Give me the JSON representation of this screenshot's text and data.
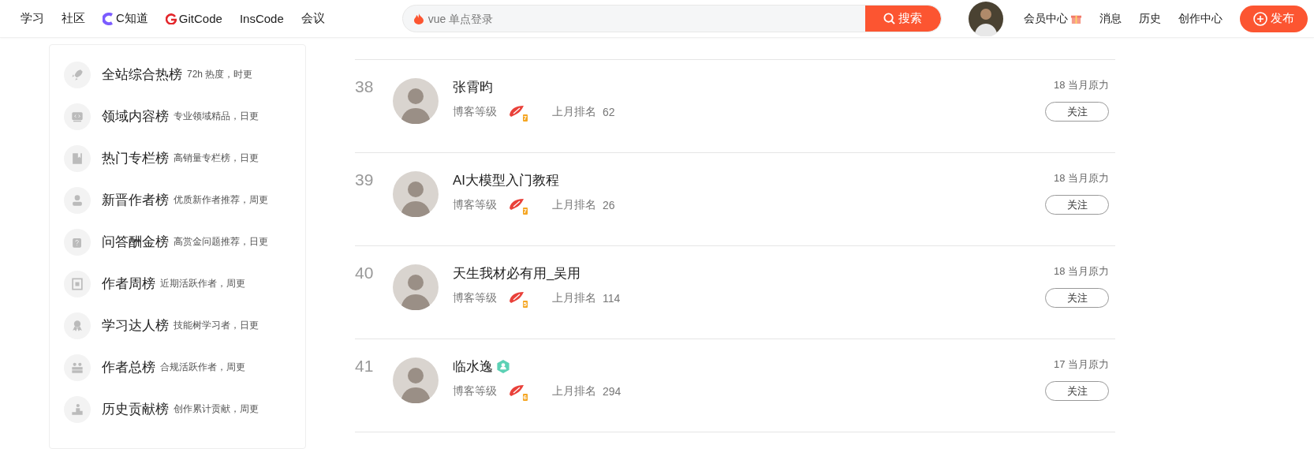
{
  "nav": {
    "links": [
      {
        "label": "学习",
        "kind": "plain"
      },
      {
        "label": "社区",
        "kind": "plain"
      },
      {
        "label": "C知道",
        "kind": "cknow"
      },
      {
        "label": "GitCode",
        "kind": "gitcode"
      },
      {
        "label": "InsCode",
        "kind": "plain"
      },
      {
        "label": "会议",
        "kind": "plain"
      }
    ],
    "search": {
      "placeholder": "vue 单点登录",
      "button": "搜索"
    },
    "user_links": [
      {
        "label": "会员中心",
        "gift": true
      },
      {
        "label": "消息",
        "gift": false
      },
      {
        "label": "历史",
        "gift": false
      },
      {
        "label": "创作中心",
        "gift": false
      }
    ],
    "publish": "发布"
  },
  "sidebar": {
    "items": [
      {
        "kind": "rocket",
        "title": "全站综合热榜",
        "desc": "72h 热度，时更",
        "selected": false
      },
      {
        "kind": "code",
        "title": "领域内容榜",
        "desc": "专业领域精品，日更",
        "selected": false
      },
      {
        "kind": "book",
        "title": "热门专栏榜",
        "desc": "高销量专栏榜，日更",
        "selected": false
      },
      {
        "kind": "person",
        "title": "新晋作者榜",
        "desc": "优质新作者推荐，周更",
        "selected": false
      },
      {
        "kind": "question",
        "title": "问答酬金榜",
        "desc": "高赏金问题推荐，日更",
        "selected": false
      },
      {
        "kind": "calendar",
        "title": "作者周榜",
        "desc": "近期活跃作者，周更",
        "selected": false
      },
      {
        "kind": "award",
        "title": "学习达人榜",
        "desc": "技能树学习者，日更",
        "selected": false
      },
      {
        "kind": "group",
        "title": "作者总榜",
        "desc": "合规活跃作者，周更",
        "selected": false
      },
      {
        "kind": "podium",
        "title": "历史贡献榜",
        "desc": "创作累计贡献，周更",
        "selected": false
      }
    ]
  },
  "ranking": {
    "rows": [
      {
        "rank": "38",
        "name": "张霄昀",
        "verified": false,
        "level_label": "博客等级",
        "blog_level": "7",
        "last_month_label": "上月排名",
        "last_month": "62",
        "score": "18 当月原力",
        "follow": "关注"
      },
      {
        "rank": "39",
        "name": "AI大模型入门教程",
        "verified": false,
        "level_label": "博客等级",
        "blog_level": "7",
        "last_month_label": "上月排名",
        "last_month": "26",
        "score": "18 当月原力",
        "follow": "关注"
      },
      {
        "rank": "40",
        "name": "天生我材必有用_吴用",
        "verified": false,
        "level_label": "博客等级",
        "blog_level": "5",
        "last_month_label": "上月排名",
        "last_month": "114",
        "score": "18 当月原力",
        "follow": "关注"
      },
      {
        "rank": "41",
        "name": "临水逸",
        "verified": true,
        "level_label": "博客等级",
        "blog_level": "6",
        "last_month_label": "上月排名",
        "last_month": "294",
        "score": "17 当月原力",
        "follow": "关注"
      }
    ]
  }
}
